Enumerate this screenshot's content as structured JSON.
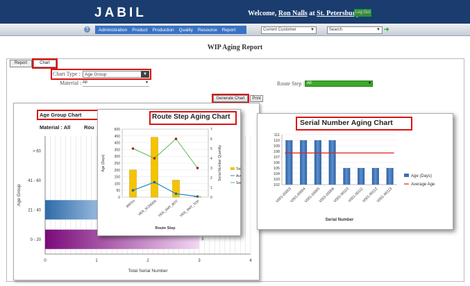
{
  "header": {
    "logo": "JABIL",
    "welcome": "Welcome,",
    "user": "Ron Nalls",
    "at": "at",
    "location": "St. Petersburg, FL",
    "logout": "Log Out"
  },
  "nav": {
    "items": [
      "Administration",
      "Product",
      "Production",
      "Quality",
      "Resource",
      "Report"
    ],
    "customer_select": "Current Customer",
    "search_placeholder": "Search",
    "go_icon": "arrow-right-icon"
  },
  "page_title": "WIP Aging Report",
  "tabs": {
    "report": "Report",
    "chart": "Chart"
  },
  "filters": {
    "chart_type_label": "Chart Type :",
    "chart_type_value": "Age Group",
    "material_label": "Material :",
    "material_value": "All",
    "route_step_label": "Route Step :",
    "route_step_value": "All"
  },
  "buttons": {
    "generate": "Generate Chart",
    "print": "Print"
  },
  "colors": {
    "header": "#1b3c6e",
    "nav": "#3a73c4",
    "annotation": "#dd1111",
    "route_step_select": "#3aaa2a"
  },
  "age_group_chart": {
    "label": "Age Group Chart",
    "material_label": "Material : All",
    "route_label_fragment": "Rou",
    "chart_data": {
      "type": "bar",
      "orientation": "horizontal",
      "categories": [
        "> 60",
        "41 - 60",
        "21 - 40",
        "0 - 20"
      ],
      "values": [
        null,
        null,
        null,
        3
      ],
      "data_labels": [
        "",
        "",
        "",
        "3"
      ],
      "xlabel": "Total Serial Number",
      "ylabel": "Age Group",
      "xlim": [
        0,
        4
      ],
      "xticks": [
        "0",
        "1",
        "2",
        "3",
        "4"
      ],
      "grid": true
    }
  },
  "route_step_chart": {
    "label": "Route Step Aging Chart",
    "chart_data": {
      "type": "bar",
      "categories": [
        "BIRTH",
        "VER_SCREEN",
        "VER_SMT_BOT",
        "VER_SMT_TOP"
      ],
      "series": [
        {
          "name": "Total Age",
          "type": "bar",
          "values": [
            200,
            440,
            125,
            5
          ]
        },
        {
          "name": "Average Age",
          "type": "line",
          "axis": "left",
          "values": [
            50,
            110,
            25,
            5
          ]
        },
        {
          "name": "Serial Number Quantity",
          "type": "line",
          "axis": "right",
          "values": [
            5,
            4,
            6,
            3
          ]
        }
      ],
      "legend_labels": [
        "Total A",
        "Averag",
        "Serial"
      ],
      "xlabel": "Route Step",
      "ylabel": "Age (Days)",
      "y2label": "Serial Number Quantity",
      "ylim": [
        0,
        500
      ],
      "yticks": [
        "0",
        "50",
        "100",
        "150",
        "200",
        "250",
        "300",
        "350",
        "400",
        "450",
        "500"
      ],
      "y2lim": [
        0,
        7
      ],
      "y2ticks": [
        "0",
        "1",
        "2",
        "3",
        "4",
        "5",
        "6",
        "7"
      ],
      "legend": "right"
    }
  },
  "serial_chart": {
    "label": "Serial Number Aging Chart",
    "chart_data": {
      "type": "bar",
      "categories": [
        "V001-00003",
        "V001-00004",
        "V001-00005",
        "V001-00006",
        "V001-00110",
        "V001-00111",
        "V001-00112",
        "V001-00113"
      ],
      "series": [
        {
          "name": "Age (Days)",
          "type": "bar",
          "values": [
            110,
            110,
            110,
            110,
            105,
            105,
            105,
            105
          ]
        },
        {
          "name": "Average Age",
          "type": "line",
          "values": [
            107.7,
            107.7,
            107.7,
            107.7,
            107.7,
            107.7,
            107.7,
            107.7
          ]
        }
      ],
      "xlabel": "Serial Number",
      "ylim": [
        102,
        111
      ],
      "yticks": [
        "102",
        "103",
        "104",
        "105",
        "106",
        "107",
        "108",
        "109",
        "110",
        "111"
      ],
      "legend": "right"
    }
  }
}
